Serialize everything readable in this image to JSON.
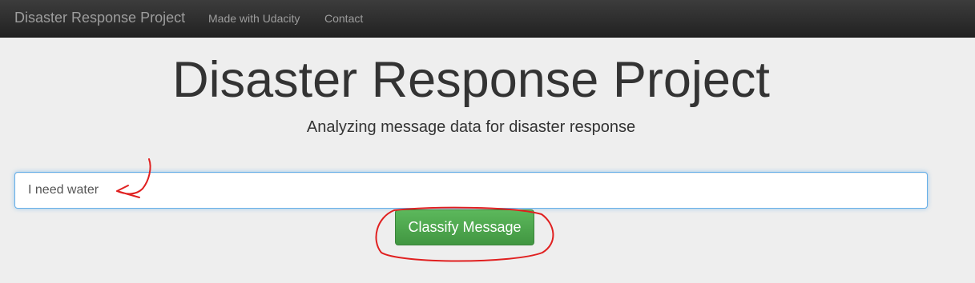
{
  "navbar": {
    "brand": "Disaster Response Project",
    "links": [
      "Made with Udacity",
      "Contact"
    ],
    "background_color": "#222222",
    "text_color": "#9d9d9d"
  },
  "header": {
    "title": "Disaster Response Project",
    "subtitle": "Analyzing message data for disaster response"
  },
  "form": {
    "query_value": "I need water",
    "classify_label": "Classify Message",
    "button_color": "#5cb85c",
    "input_focus_color": "#66afe9"
  },
  "annotations": {
    "color": "#e02020",
    "items": [
      "red-arrow-pointing-to-input",
      "red-circle-around-classify-button"
    ]
  }
}
